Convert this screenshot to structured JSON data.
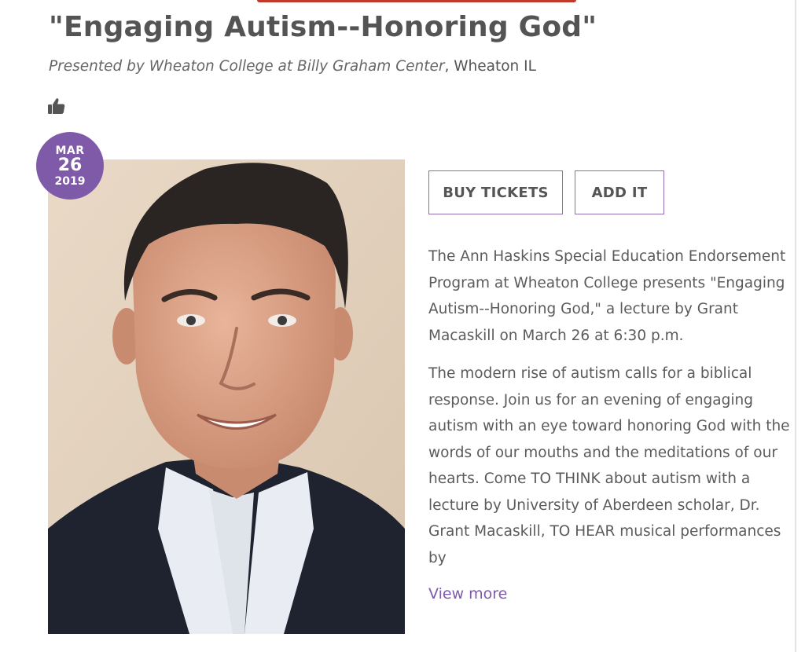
{
  "event": {
    "title": "\"Engaging Autism--Honoring God\"",
    "presenter_italic": "Presented by Wheaton College at Billy Graham Center",
    "location": ", Wheaton IL"
  },
  "icons": {
    "like": "thumbs-up-icon"
  },
  "date_badge": {
    "month": "MAR",
    "day": "26",
    "year": "2019"
  },
  "actions": {
    "buy_tickets": "BUY TICKETS",
    "add_it": "ADD IT"
  },
  "description": {
    "paragraph_1": "The Ann Haskins Special Education Endorsement Program at Wheaton College presents \"Engaging Autism--Honoring God,\" a lecture by Grant Macaskill on March 26 at 6:30 p.m.",
    "paragraph_2": "The modern rise of autism calls for a biblical response. Join us for an evening of engaging autism with an eye toward honoring God with the words of our mouths and the meditations of our hearts. Come TO THINK about autism with a lecture by University of Aberdeen scholar, Dr. Grant Macaskill, TO HEAR musical performances by",
    "view_more": "View more"
  },
  "colors": {
    "accent_purple": "#7f5aa8",
    "top_accent_red": "#c0392b",
    "text_gray": "#555555"
  }
}
